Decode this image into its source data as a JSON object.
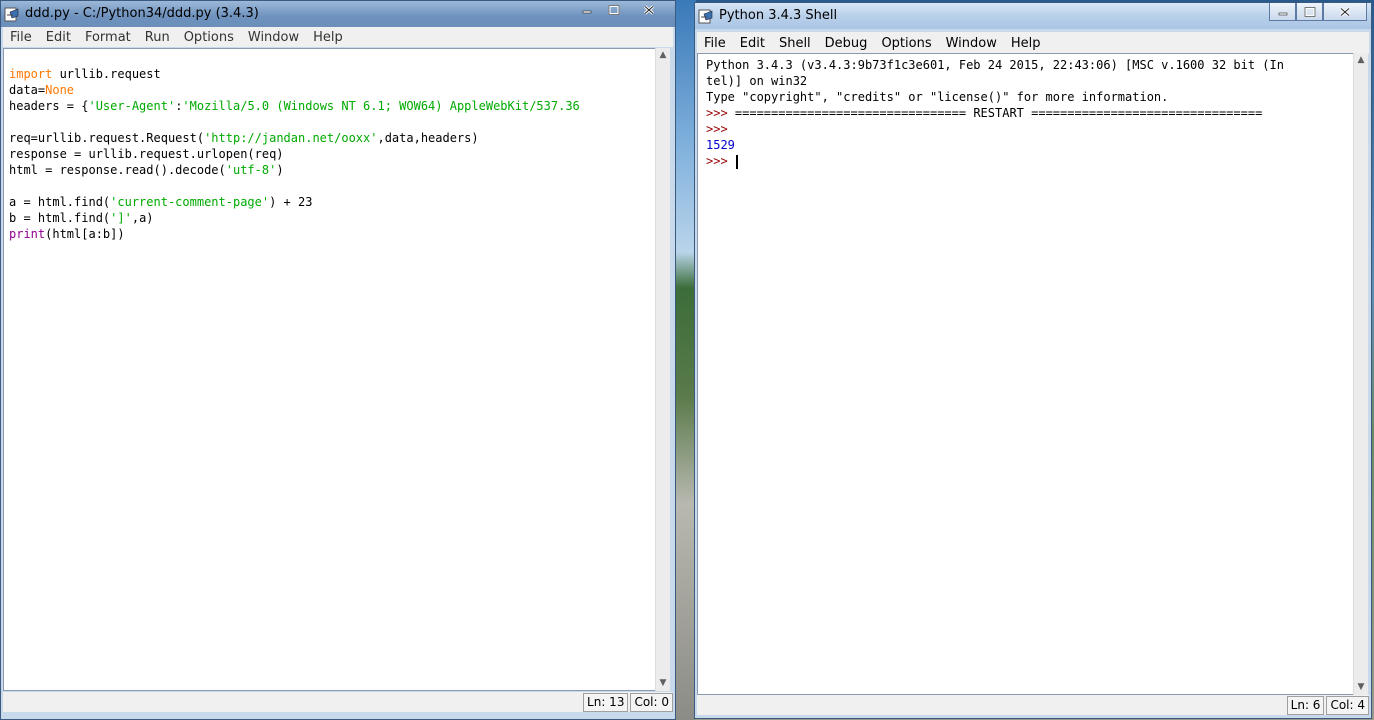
{
  "editor_window": {
    "title": "ddd.py - C:/Python34/ddd.py (3.4.3)",
    "menu": [
      "File",
      "Edit",
      "Format",
      "Run",
      "Options",
      "Window",
      "Help"
    ],
    "code": [
      [
        {
          "t": "import",
          "c": "kw"
        },
        {
          "t": " urllib.request",
          "c": ""
        }
      ],
      [
        {
          "t": "data=",
          "c": ""
        },
        {
          "t": "None",
          "c": "kw"
        }
      ],
      [
        {
          "t": "headers = {",
          "c": ""
        },
        {
          "t": "'User-Agent'",
          "c": "str"
        },
        {
          "t": ":",
          "c": ""
        },
        {
          "t": "'Mozilla/5.0 (Windows NT 6.1; WOW64) AppleWebKit/537.36",
          "c": "str"
        }
      ],
      [],
      [
        {
          "t": "req=urllib.request.Request(",
          "c": ""
        },
        {
          "t": "'http://jandan.net/ooxx'",
          "c": "str"
        },
        {
          "t": ",data,headers)",
          "c": ""
        }
      ],
      [
        {
          "t": "response = urllib.request.urlopen(req)",
          "c": ""
        }
      ],
      [
        {
          "t": "html = response.read().decode(",
          "c": ""
        },
        {
          "t": "'utf-8'",
          "c": "str"
        },
        {
          "t": ")",
          "c": ""
        }
      ],
      [],
      [
        {
          "t": "a = html.find(",
          "c": ""
        },
        {
          "t": "'current-comment-page'",
          "c": "str"
        },
        {
          "t": ") + 23",
          "c": ""
        }
      ],
      [
        {
          "t": "b = html.find(",
          "c": ""
        },
        {
          "t": "']'",
          "c": "str"
        },
        {
          "t": ",a)",
          "c": ""
        }
      ],
      [
        {
          "t": "print",
          "c": "bi"
        },
        {
          "t": "(html[a:b])",
          "c": ""
        }
      ]
    ],
    "status": {
      "line": "Ln: 13",
      "col": "Col: 0"
    }
  },
  "shell_window": {
    "title": "Python 3.4.3 Shell",
    "menu": [
      "File",
      "Edit",
      "Shell",
      "Debug",
      "Options",
      "Window",
      "Help"
    ],
    "lines": [
      [
        {
          "t": "Python 3.4.3 (v3.4.3:9b73f1c3e601, Feb 24 2015, 22:43:06) [MSC v.1600 32 bit (In",
          "c": ""
        }
      ],
      [
        {
          "t": "tel)] on win32",
          "c": ""
        }
      ],
      [
        {
          "t": "Type \"copyright\", \"credits\" or \"license()\" for more information.",
          "c": ""
        }
      ],
      [
        {
          "t": ">>> ",
          "c": "prompt"
        },
        {
          "t": "================================ RESTART ================================",
          "c": ""
        }
      ],
      [
        {
          "t": ">>> ",
          "c": "prompt"
        }
      ],
      [
        {
          "t": "1529",
          "c": "outv"
        }
      ],
      [
        {
          "t": ">>> ",
          "c": "prompt"
        },
        {
          "t": "",
          "c": "caret"
        }
      ]
    ],
    "status": {
      "line": "Ln: 6",
      "col": "Col: 4"
    }
  },
  "icons": [
    "python-idle-icon",
    "minimize-icon",
    "maximize-icon",
    "close-icon",
    "scroll-up-arrow-icon",
    "scroll-down-arrow-icon"
  ]
}
